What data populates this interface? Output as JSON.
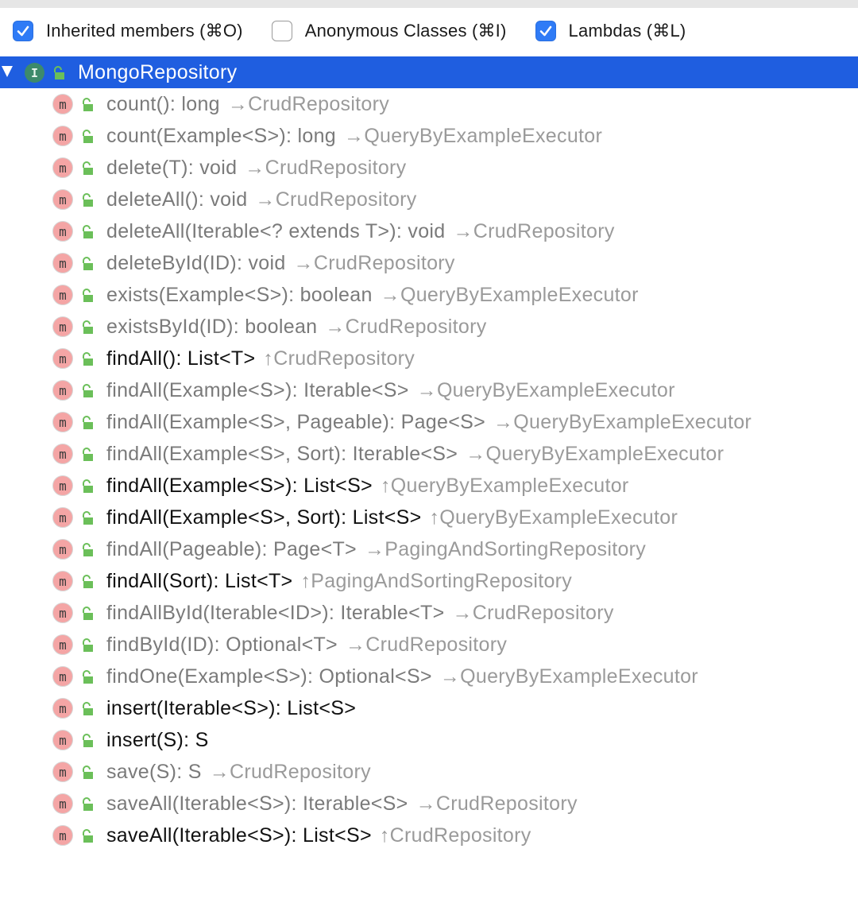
{
  "colors": {
    "selection": "#1f5ee0",
    "checkbox_on": "#2f7bf6",
    "inherited_text": "#7a7a7a",
    "own_text": "#111111",
    "source_text": "#9a9a9a",
    "method_icon": "#f4a5a5",
    "lock_icon": "#6bbf59",
    "interface_icon": "#3d8a6b"
  },
  "toolbar": {
    "options": [
      {
        "label": "Inherited members (⌘O)",
        "checked": true
      },
      {
        "label": "Anonymous Classes (⌘I)",
        "checked": false
      },
      {
        "label": "Lambdas (⌘L)",
        "checked": true
      }
    ]
  },
  "root": {
    "icon_letter": "I",
    "label": "MongoRepository",
    "expanded": true,
    "selected": true
  },
  "members": [
    {
      "sig": "count(): long",
      "src": "→CrudRepository",
      "inherited": true
    },
    {
      "sig": "count(Example<S>): long",
      "src": "→QueryByExampleExecutor",
      "inherited": true
    },
    {
      "sig": "delete(T): void",
      "src": "→CrudRepository",
      "inherited": true
    },
    {
      "sig": "deleteAll(): void",
      "src": "→CrudRepository",
      "inherited": true
    },
    {
      "sig": "deleteAll(Iterable<? extends T>): void",
      "src": "→CrudRepository",
      "inherited": true
    },
    {
      "sig": "deleteById(ID): void",
      "src": "→CrudRepository",
      "inherited": true
    },
    {
      "sig": "exists(Example<S>): boolean",
      "src": "→QueryByExampleExecutor",
      "inherited": true
    },
    {
      "sig": "existsById(ID): boolean",
      "src": "→CrudRepository",
      "inherited": true
    },
    {
      "sig": "findAll(): List<T>",
      "src": "↑CrudRepository",
      "inherited": false
    },
    {
      "sig": "findAll(Example<S>): Iterable<S>",
      "src": "→QueryByExampleExecutor",
      "inherited": true
    },
    {
      "sig": "findAll(Example<S>, Pageable): Page<S>",
      "src": "→QueryByExampleExecutor",
      "inherited": true
    },
    {
      "sig": "findAll(Example<S>, Sort): Iterable<S>",
      "src": "→QueryByExampleExecutor",
      "inherited": true
    },
    {
      "sig": "findAll(Example<S>): List<S>",
      "src": "↑QueryByExampleExecutor",
      "inherited": false
    },
    {
      "sig": "findAll(Example<S>, Sort): List<S>",
      "src": "↑QueryByExampleExecutor",
      "inherited": false
    },
    {
      "sig": "findAll(Pageable): Page<T>",
      "src": "→PagingAndSortingRepository",
      "inherited": true
    },
    {
      "sig": "findAll(Sort): List<T>",
      "src": "↑PagingAndSortingRepository",
      "inherited": false
    },
    {
      "sig": "findAllById(Iterable<ID>): Iterable<T>",
      "src": "→CrudRepository",
      "inherited": true
    },
    {
      "sig": "findById(ID): Optional<T>",
      "src": "→CrudRepository",
      "inherited": true
    },
    {
      "sig": "findOne(Example<S>): Optional<S>",
      "src": "→QueryByExampleExecutor",
      "inherited": true
    },
    {
      "sig": "insert(Iterable<S>): List<S>",
      "src": "",
      "inherited": false
    },
    {
      "sig": "insert(S): S",
      "src": "",
      "inherited": false
    },
    {
      "sig": "save(S): S",
      "src": "→CrudRepository",
      "inherited": true
    },
    {
      "sig": "saveAll(Iterable<S>): Iterable<S>",
      "src": "→CrudRepository",
      "inherited": true
    },
    {
      "sig": "saveAll(Iterable<S>): List<S>",
      "src": "↑CrudRepository",
      "inherited": false
    }
  ],
  "method_icon_letter": "m"
}
